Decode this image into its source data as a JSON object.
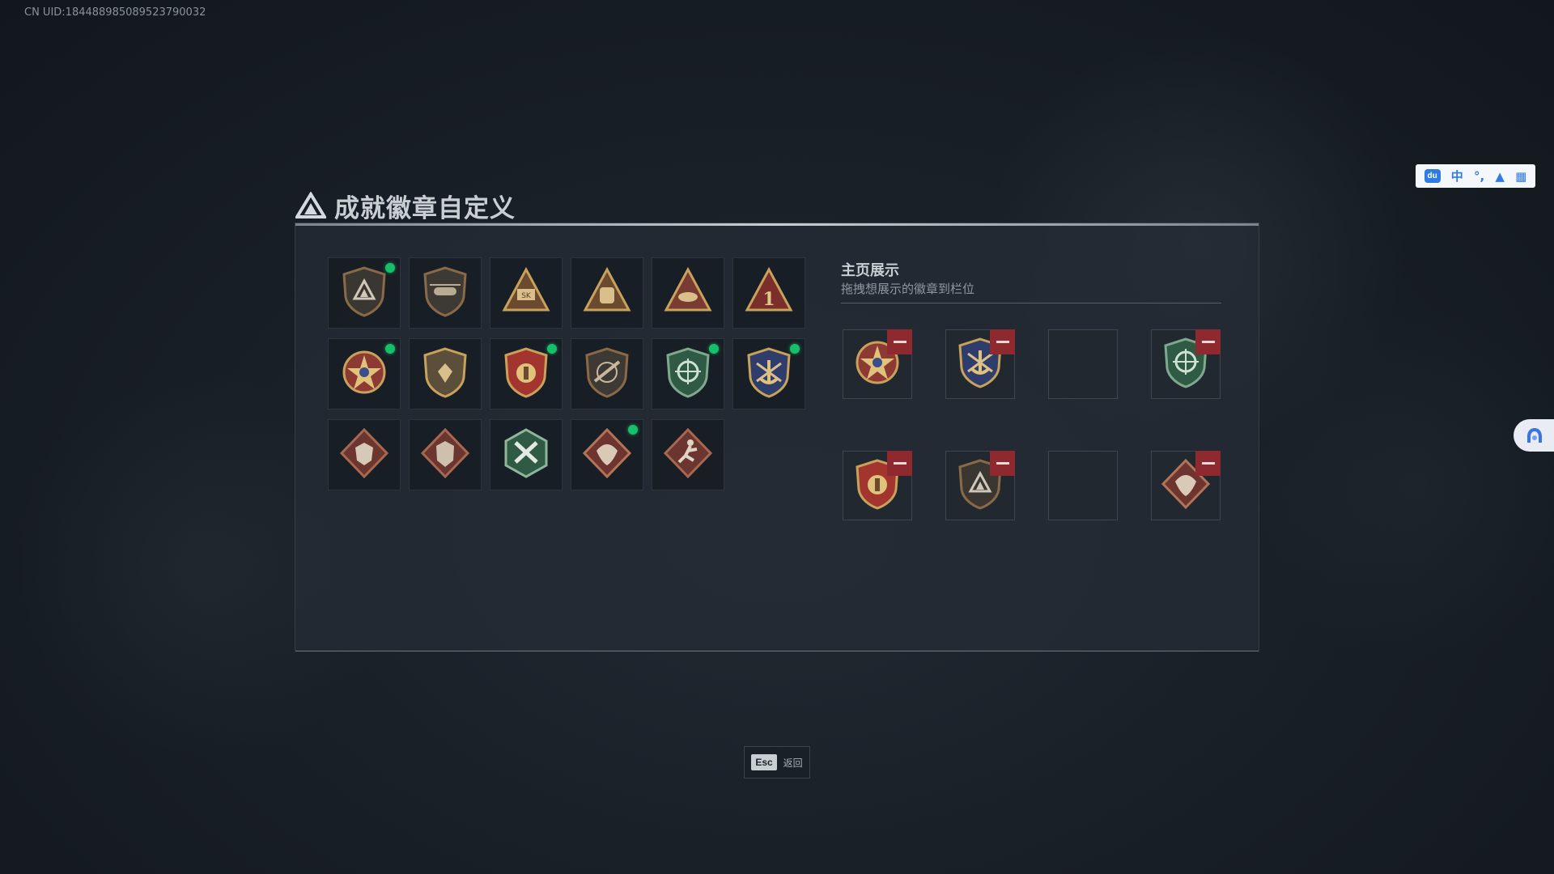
{
  "uid_text": "CN UID:1844889850895237900​32",
  "title": "成就徽章自定义",
  "showcase": {
    "title": "主页展示",
    "subtitle": "拖拽想展示的徽章到栏位"
  },
  "esc": {
    "key": "Esc",
    "label": "返回"
  },
  "ime": {
    "mode": "中",
    "punct": "°,",
    "logo": "du"
  },
  "badges": [
    {
      "icon": "shield-triangle-icon",
      "new": true
    },
    {
      "icon": "shield-helicopter-icon",
      "new": false
    },
    {
      "icon": "triangle-sk-icon",
      "new": false
    },
    {
      "icon": "triangle-bag-icon",
      "new": false
    },
    {
      "icon": "triangle-hand-icon",
      "new": false
    },
    {
      "icon": "triangle-number-one-icon",
      "new": false
    },
    {
      "icon": "star-medal-icon",
      "new": true
    },
    {
      "icon": "shield-emblem-icon",
      "new": false
    },
    {
      "icon": "shield-wings-gold-icon",
      "new": true
    },
    {
      "icon": "shield-rifle-icon",
      "new": false
    },
    {
      "icon": "green-crosshair-shield-icon",
      "new": true
    },
    {
      "icon": "gold-anchor-shield-icon",
      "new": true
    },
    {
      "icon": "wolf-diamond-icon",
      "new": false
    },
    {
      "icon": "wolf-diamond-alt-icon",
      "new": false
    },
    {
      "icon": "green-hex-tools-icon",
      "new": false
    },
    {
      "icon": "dragon-diamond-icon",
      "new": true
    },
    {
      "icon": "runner-diamond-icon",
      "new": false
    }
  ],
  "slots": [
    {
      "icon": "star-medal-icon",
      "filled": true
    },
    {
      "icon": "gold-anchor-shield-icon",
      "filled": true
    },
    {
      "icon": "",
      "filled": false
    },
    {
      "icon": "green-crosshair-shield-icon",
      "filled": true
    },
    {
      "icon": "shield-wings-gold-icon",
      "filled": true
    },
    {
      "icon": "shield-triangle-icon",
      "filled": true
    },
    {
      "icon": "",
      "filled": false
    },
    {
      "icon": "dragon-diamond-icon",
      "filled": true
    }
  ],
  "colors": {
    "new_dot": "#16c06a",
    "remove": "#8e2a2f",
    "gold": "#c8a25a",
    "bronze": "#8a6a46",
    "green": "#2f6b4a",
    "red": "#8e3a34"
  }
}
